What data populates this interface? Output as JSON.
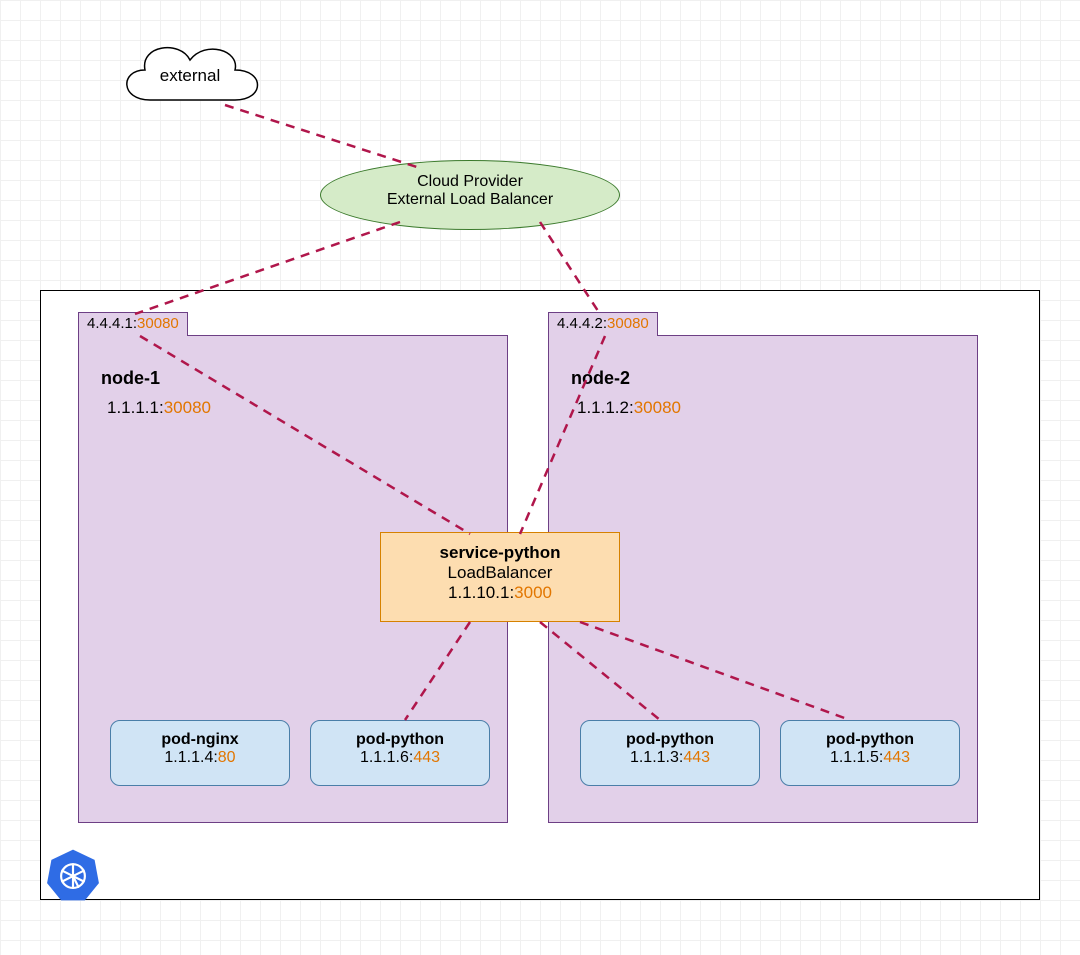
{
  "external": {
    "label": "external"
  },
  "load_balancer": {
    "line1": "Cloud Provider",
    "line2": "External Load Balancer"
  },
  "cluster": {},
  "nodes": [
    {
      "name": "node-1",
      "public_ip": "4.4.4.1:",
      "public_port": "30080",
      "internal_ip": "1.1.1.1:",
      "internal_port": "30080"
    },
    {
      "name": "node-2",
      "public_ip": "4.4.4.2:",
      "public_port": "30080",
      "internal_ip": "1.1.1.2:",
      "internal_port": "30080"
    }
  ],
  "service": {
    "name": "service-python",
    "type": "LoadBalancer",
    "ip": "1.1.10.1:",
    "port": "3000"
  },
  "pods": [
    {
      "name": "pod-nginx",
      "ip": "1.1.1.4:",
      "port": "80"
    },
    {
      "name": "pod-python",
      "ip": "1.1.1.6:",
      "port": "443"
    },
    {
      "name": "pod-python",
      "ip": "1.1.1.3:",
      "port": "443"
    },
    {
      "name": "pod-python",
      "ip": "1.1.1.5:",
      "port": "443"
    }
  ],
  "colors": {
    "dashed": "#b0164b",
    "port": "#e27600"
  }
}
